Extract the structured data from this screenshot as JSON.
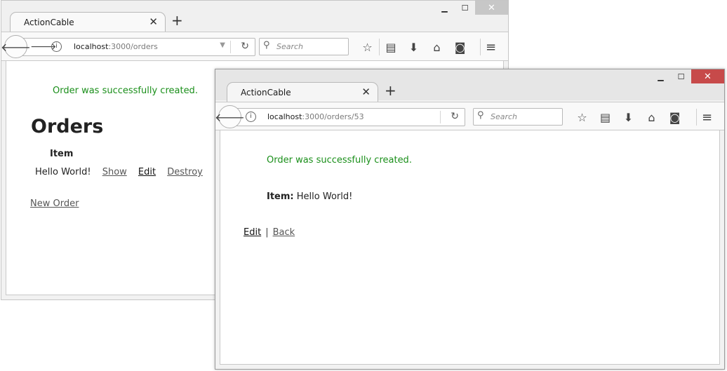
{
  "colors": {
    "notice": "#1a8f1a",
    "close_active": "#c74a4a"
  },
  "back_window": {
    "tab": {
      "title": "ActionCable",
      "close": "✕"
    },
    "new_tab": "+",
    "url": {
      "host": "localhost",
      "rest": ":3000/orders"
    },
    "search_placeholder": "Search",
    "page": {
      "notice": "Order was successfully created.",
      "heading": "Orders",
      "column_header": "Item",
      "rows": [
        {
          "item": "Hello World!",
          "show": "Show",
          "edit": "Edit",
          "destroy": "Destroy"
        }
      ],
      "new_link": "New Order"
    }
  },
  "front_window": {
    "tab": {
      "title": "ActionCable",
      "close": "✕"
    },
    "new_tab": "+",
    "url": {
      "host": "localhost",
      "rest": ":3000/orders/53"
    },
    "search_placeholder": "Search",
    "page": {
      "notice": "Order was successfully created.",
      "item_label": "Item:",
      "item_value": "Hello World!",
      "edit_link": "Edit",
      "separator": "|",
      "back_link": "Back"
    }
  },
  "icons": {
    "minimize": "minimize-icon",
    "maximize": "maximize-icon",
    "close": "close-icon",
    "back": "back-arrow-icon",
    "forward": "forward-arrow-icon",
    "info": "info-icon",
    "reload": "reload-icon",
    "search": "search-icon",
    "bookmark": "star-icon",
    "reading_list": "clipboard-icon",
    "download": "download-icon",
    "home": "home-icon",
    "pocket": "pocket-icon",
    "menu": "hamburger-menu-icon"
  }
}
